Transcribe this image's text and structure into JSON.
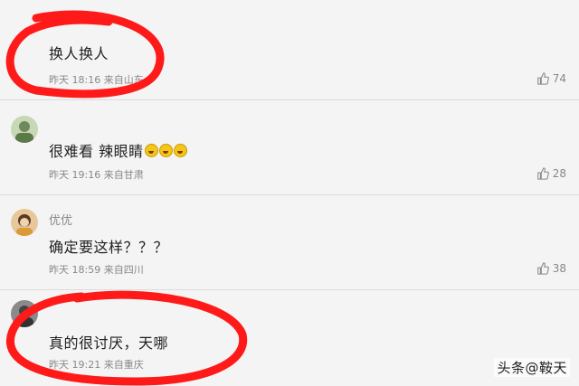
{
  "comments": [
    {
      "text": "换人换人",
      "time": "昨天 18:16",
      "location": "来自山东",
      "likes": "74"
    },
    {
      "text": "很难看 辣眼睛",
      "emoji_count": 3,
      "emoji_icon": "laughing-tears-emoji",
      "time": "昨天 19:16",
      "location": "来自甘肃",
      "likes": "28"
    },
    {
      "username": "优优",
      "text": "确定要这样？？？",
      "time": "昨天 18:59",
      "location": "来自四川",
      "likes": "38"
    },
    {
      "text": "真的很讨厌，天哪",
      "time": "昨天 19:21",
      "location": "来自重庆",
      "likes": ""
    }
  ],
  "like_icon": "thumbs-up-icon",
  "annotation_color": "#ff1a1a",
  "watermark": "头条@鞍天"
}
